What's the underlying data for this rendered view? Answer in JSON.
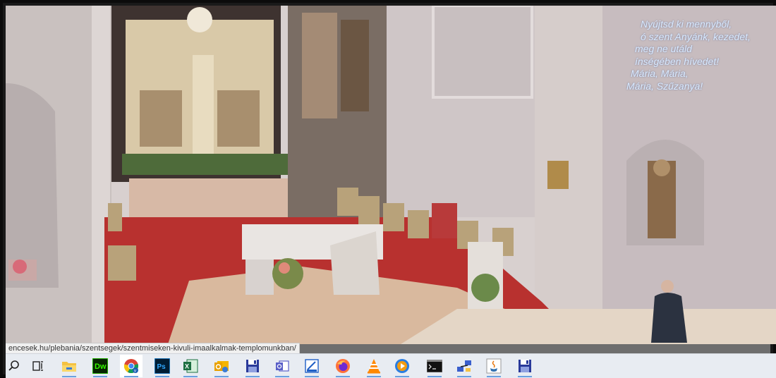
{
  "stream": {
    "lyrics": [
      "Nyújtsd ki mennyből,",
      "ó szent Anyánk, kezedet,",
      "meg ne utáld",
      "ínségében hívedet!",
      "Mária, Mária,",
      "Mária, Szűzanya!"
    ]
  },
  "statusbar": {
    "url": "encesek.hu/plebania/szentsegek/szentmiseken-kivuli-imaalkalmak-templomunkban/"
  },
  "taskbar": {
    "items": [
      {
        "name": "search",
        "icon": "search-icon"
      },
      {
        "name": "task-view",
        "icon": "task-view-icon"
      },
      {
        "name": "file-explorer",
        "icon": "folder-icon"
      },
      {
        "name": "dreamweaver",
        "icon": "dreamweaver-icon",
        "label": "Dw"
      },
      {
        "name": "chrome",
        "icon": "chrome-icon"
      },
      {
        "name": "photoshop",
        "icon": "photoshop-icon",
        "label": "Ps"
      },
      {
        "name": "excel",
        "icon": "excel-icon"
      },
      {
        "name": "outlook",
        "icon": "outlook-icon"
      },
      {
        "name": "save-app-1",
        "icon": "floppy-icon"
      },
      {
        "name": "outlook-2",
        "icon": "outlook-alt-icon"
      },
      {
        "name": "editor",
        "icon": "editor-icon"
      },
      {
        "name": "firefox",
        "icon": "firefox-icon"
      },
      {
        "name": "vlc",
        "icon": "vlc-icon"
      },
      {
        "name": "media-player",
        "icon": "media-player-icon"
      },
      {
        "name": "terminal",
        "icon": "terminal-icon"
      },
      {
        "name": "network",
        "icon": "network-icon"
      },
      {
        "name": "java",
        "icon": "java-icon"
      },
      {
        "name": "save-app-2",
        "icon": "floppy-icon"
      }
    ]
  },
  "colors": {
    "taskbar_bg": "#e8ecf2",
    "carpet": "#b8312f",
    "lyrics_text": "#d9eaff"
  }
}
